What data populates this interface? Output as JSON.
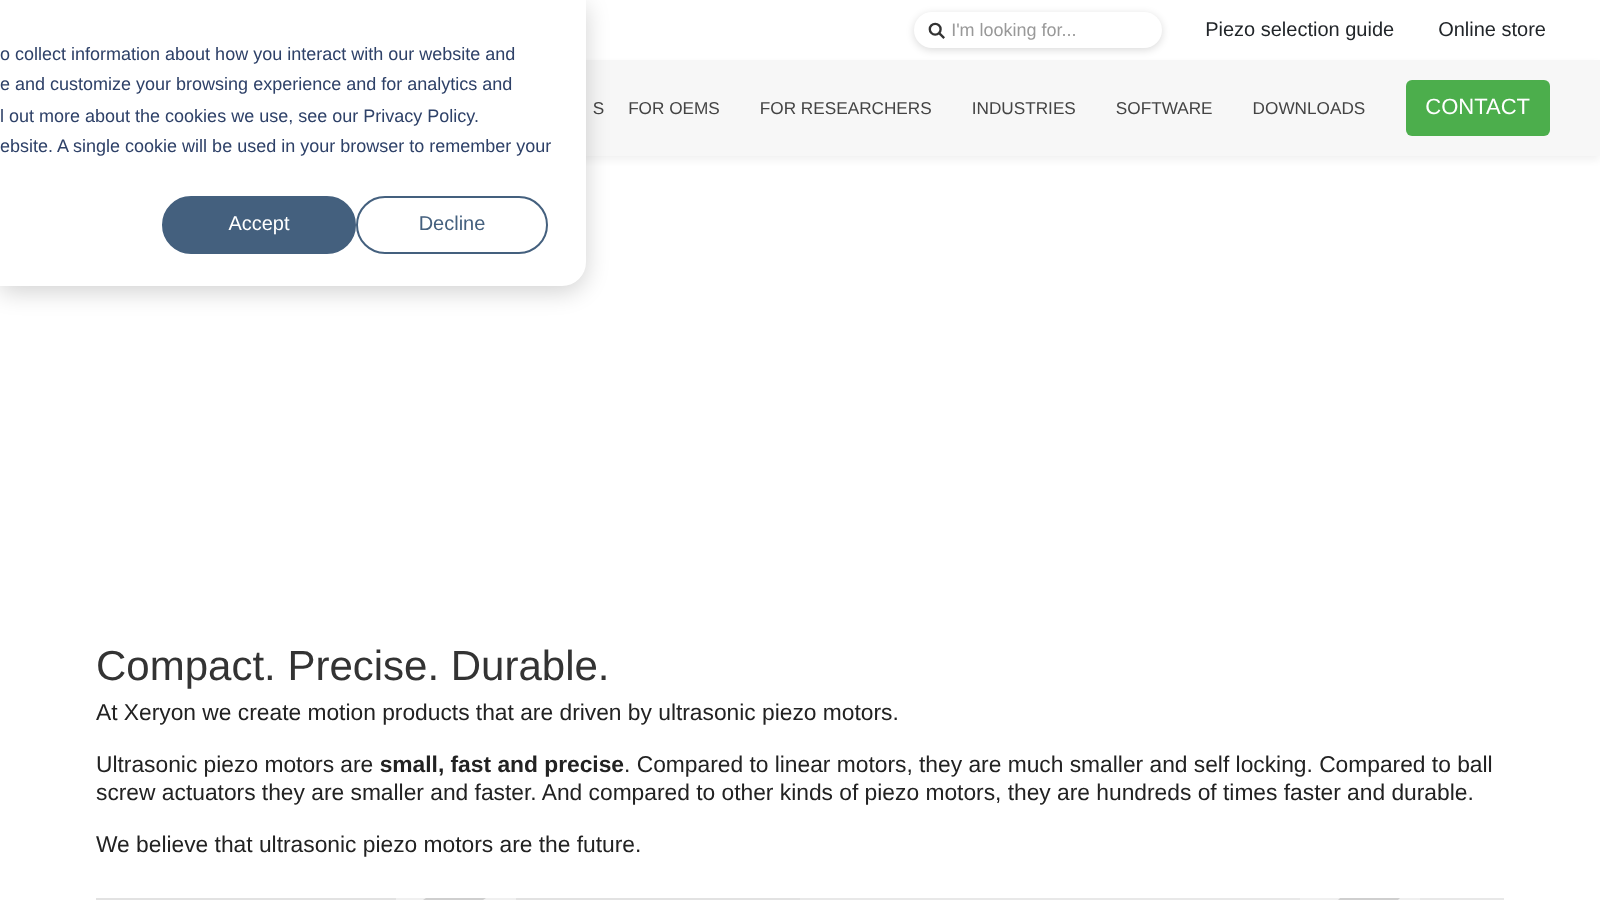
{
  "search": {
    "placeholder": "I'm looking for..."
  },
  "top_links": [
    "Piezo selection guide",
    "Online store"
  ],
  "nav": {
    "items": [
      "S",
      "FOR OEMS",
      "FOR RESEARCHERS",
      "INDUSTRIES",
      "SOFTWARE",
      "DOWNLOADS"
    ],
    "button": "CONTACT"
  },
  "cookie_banner": {
    "lines": [
      "o collect information about how you interact with our website and",
      "e and customize your browsing experience and for analytics and",
      "l out more about the cookies we use, see our Privacy Policy.",
      "ebsite. A single cookie will be used in your browser to remember your"
    ],
    "buttons": [
      {
        "label": "Accept",
        "kind": "primary"
      },
      {
        "label": "Decline",
        "kind": "outline"
      }
    ]
  },
  "content": {
    "heading": "Compact. Precise. Durable.",
    "paragraphs": [
      "At Xeryon we create motion products that are driven by ultrasonic piezo motors.",
      "Ultrasonic piezo motors are **small, fast and precise**. Compared to linear motors, they are much smaller and self locking. Compared to ball screw actuators they are smaller and faster. And compared to other kinds of piezo motors, they are hundreds of times faster and durable.",
      "We believe that ultrasonic piezo motors are the future."
    ]
  }
}
